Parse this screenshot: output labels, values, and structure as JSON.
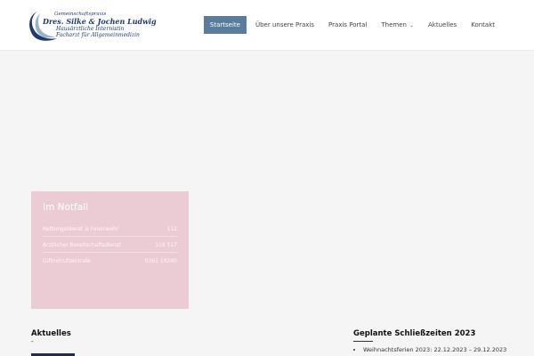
{
  "logo": {
    "line1": "Gemeinschaftspraxis",
    "line2": "Dres. Silke & Jochen Ludwig",
    "line3": "Hausärztliche Internistin",
    "line4": "Facharzt für Allgemeinmedizin"
  },
  "nav": {
    "items": [
      {
        "label": "Startseite",
        "active": true
      },
      {
        "label": "Über unsere Praxis"
      },
      {
        "label": "Praxis Portal"
      },
      {
        "label": "Themen",
        "has_dropdown": true
      },
      {
        "label": "Aktuelles"
      },
      {
        "label": "Kontakt"
      }
    ]
  },
  "notfall": {
    "title": "Im Notfall",
    "rows": [
      {
        "label": "Rettungsdienst & Feuerwehr",
        "value": "112"
      },
      {
        "label": "Ärztlicher Bereitschaftsdienst",
        "value": "116 117"
      },
      {
        "label": "Giftnotrufzentrale",
        "value": "0361 19240"
      }
    ]
  },
  "aktuelles": {
    "heading": "Aktuelles",
    "dash": "-"
  },
  "schliesszeiten": {
    "heading": "Geplante Schließzeiten 2023",
    "items": [
      "Weihnachtsferien 2023: 22.12.2023 – 29.12.2023"
    ]
  },
  "colors": {
    "nav_active_bg": "#5a7d9e",
    "notfall_bg": "#ebccd4",
    "brand_navy": "#1e3a6e"
  }
}
